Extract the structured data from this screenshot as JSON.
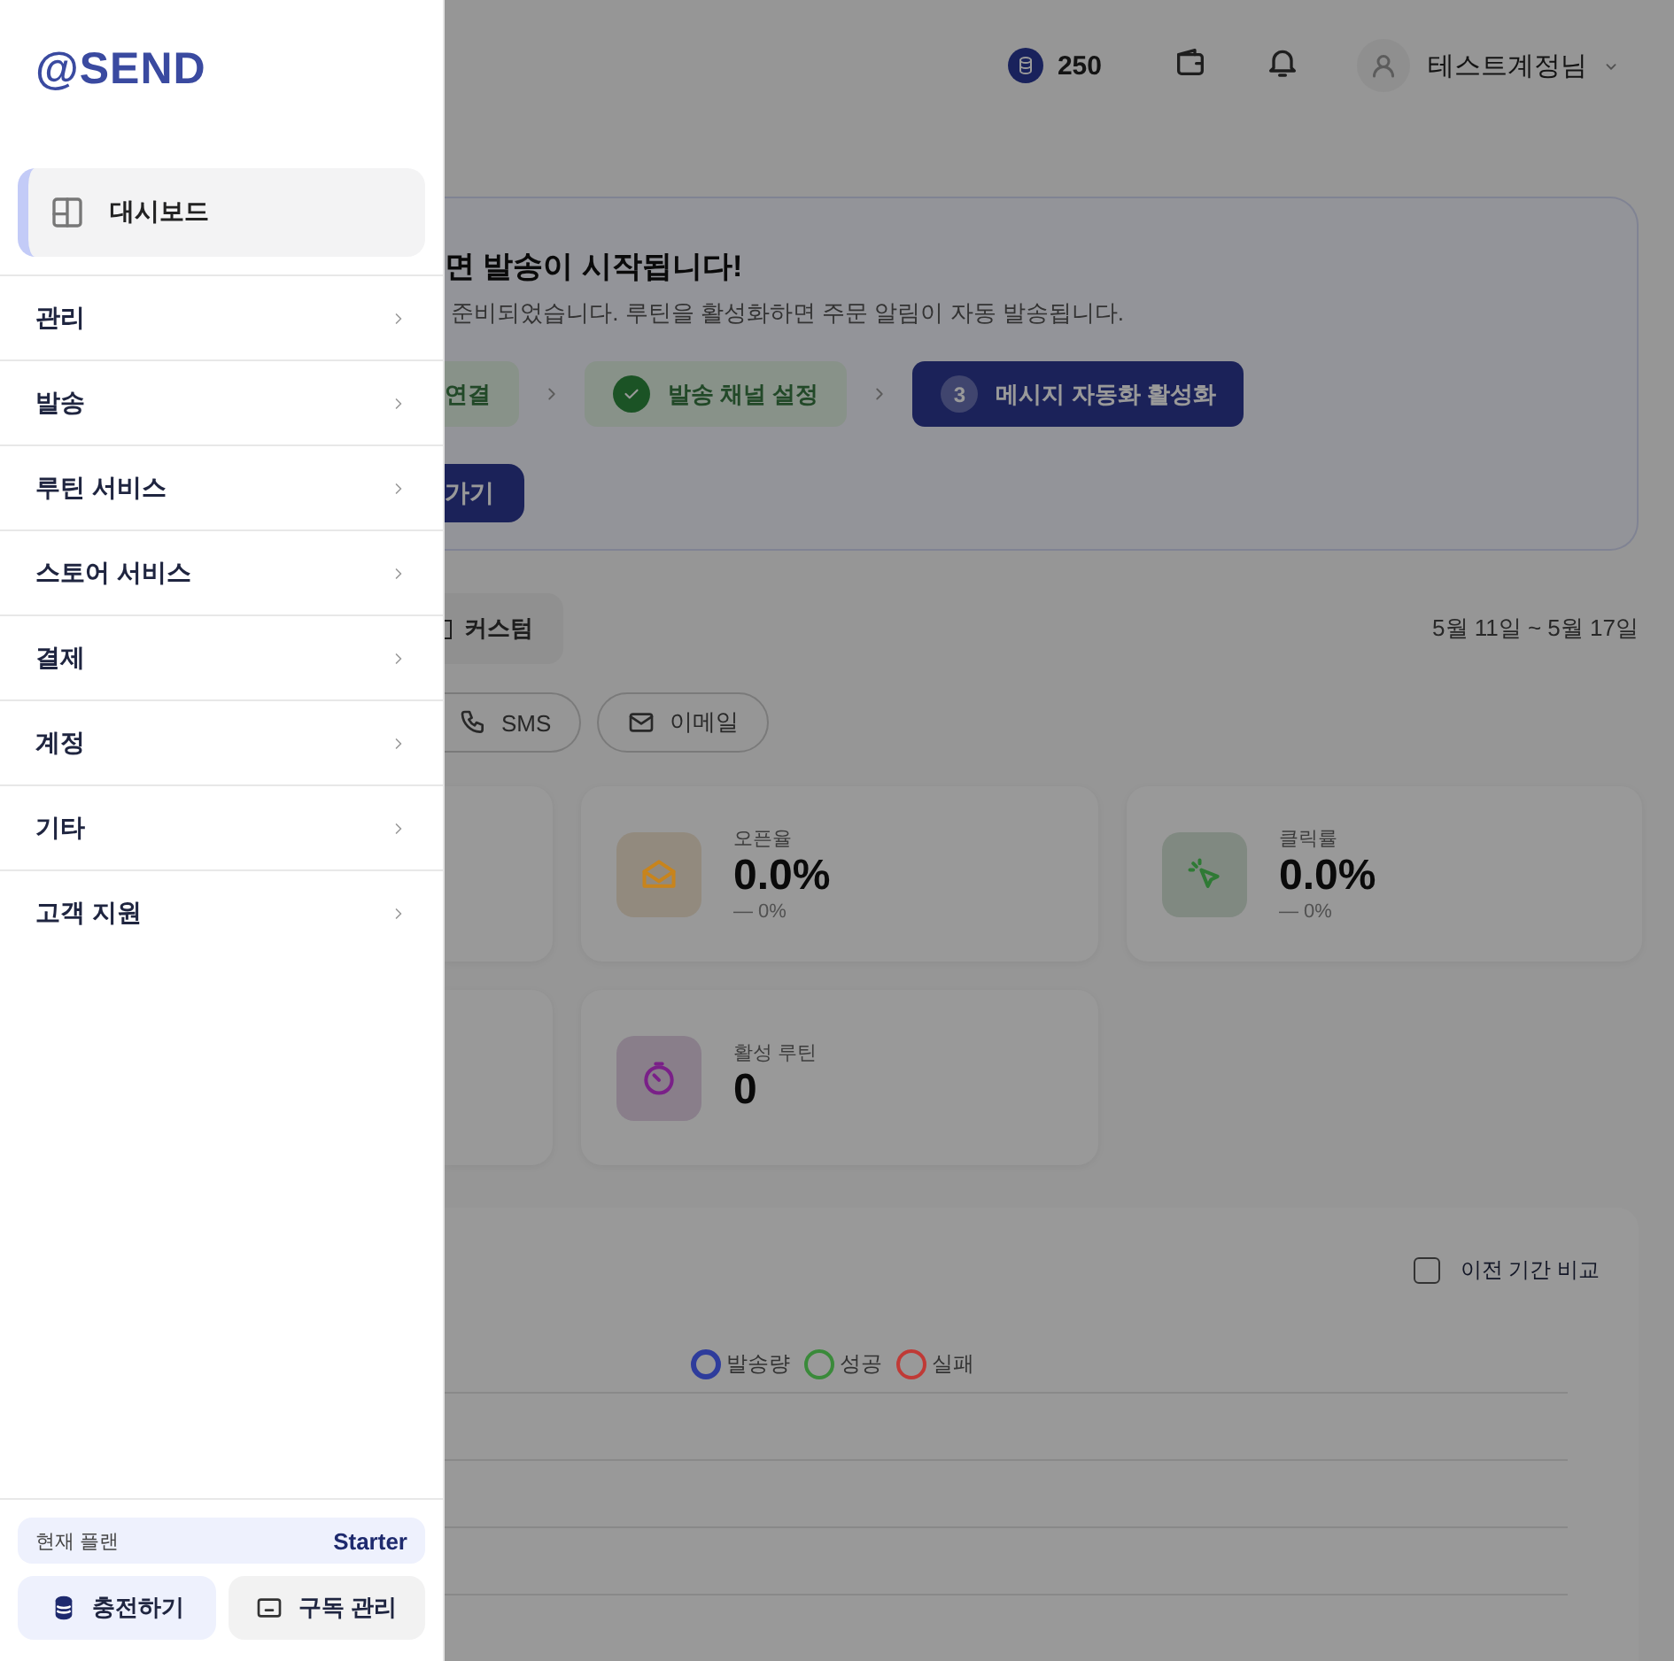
{
  "sidebar": {
    "logo": "@SEND",
    "dashboard": {
      "label": "대시보드",
      "selected": true
    },
    "sections": [
      {
        "label": "관리"
      },
      {
        "label": "발송"
      },
      {
        "label": "루틴 서비스"
      },
      {
        "label": "스토어 서비스"
      },
      {
        "label": "결제"
      },
      {
        "label": "계정"
      },
      {
        "label": "기타"
      },
      {
        "label": "고객 지원"
      }
    ],
    "plan": {
      "label": "현재 플랜",
      "value": "Starter"
    },
    "buttons": [
      {
        "label": "충전하기"
      },
      {
        "label": "구독 관리"
      }
    ]
  },
  "header": {
    "credits": "250",
    "user": "테스트계정님"
  },
  "banner": {
    "title": "면 발송이 시작됩니다!",
    "subtitle": " 준비되었습니다. 루틴을 활성화하면 주문 알림이 자동 발송됩니다.",
    "steps": [
      {
        "label": "연결",
        "done": true
      },
      {
        "label": "발송 채널 설정",
        "done": true
      },
      {
        "number": "3",
        "label": "메시지 자동화 활성화",
        "done": false
      }
    ],
    "button": "가기"
  },
  "period": {
    "custom": "커스텀",
    "range": "5월 11일 ~ 5월 17일"
  },
  "channels": [
    {
      "label": "SMS",
      "selected": false
    },
    {
      "label": "이메일",
      "selected": false
    }
  ],
  "stats": [
    {
      "kind": "stub"
    },
    {
      "kind": "card",
      "label": "오픈율",
      "value": "0.0%",
      "delta": "— 0%",
      "color": "#c8841c"
    },
    {
      "kind": "card",
      "label": "클릭률",
      "value": "0.0%",
      "delta": "— 0%",
      "color": "#2f7a35"
    },
    {
      "kind": "stub"
    },
    {
      "kind": "card",
      "label": "활성 루틴",
      "value": "0",
      "color": "#7a2088"
    }
  ],
  "chart": {
    "compare": {
      "label": "이전 기간 비교",
      "checked": false
    },
    "legend": [
      {
        "label": "발송량",
        "color": "#2e3c9c"
      },
      {
        "label": "성공",
        "color": "#3a8a3a"
      },
      {
        "label": "실패",
        "color": "#c03a36"
      }
    ]
  }
}
